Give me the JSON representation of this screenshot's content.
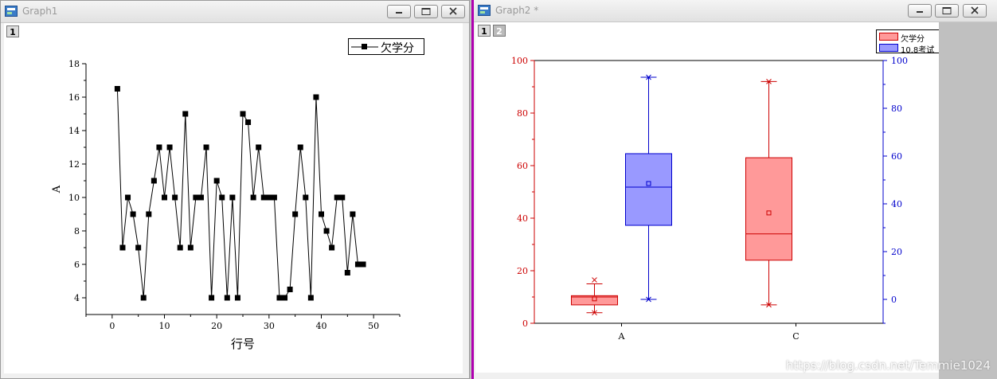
{
  "window1": {
    "title": "Graph1",
    "layer_tab": "1",
    "legend_label": "欠学分"
  },
  "window2": {
    "title": "Graph2 *",
    "layer_tabs": [
      "1",
      "2"
    ],
    "legend": [
      {
        "label": "欠学分",
        "color": "#ff9999"
      },
      {
        "label": "10.8考试",
        "color": "#9999ff"
      }
    ]
  },
  "watermark": "https://blog.csdn.net/Temmie1024",
  "chart_data": [
    {
      "type": "line",
      "xlabel": "行号",
      "ylabel": "A",
      "xlim": [
        -5,
        55
      ],
      "ylim": [
        3,
        18
      ],
      "xticks": [
        0,
        10,
        20,
        30,
        40,
        50
      ],
      "yticks": [
        4,
        6,
        8,
        10,
        12,
        14,
        16,
        18
      ],
      "markers": "square",
      "series": [
        {
          "name": "欠学分",
          "x": [
            1,
            2,
            3,
            4,
            5,
            6,
            7,
            8,
            9,
            10,
            11,
            12,
            13,
            14,
            15,
            16,
            17,
            18,
            19,
            20,
            21,
            22,
            23,
            24,
            25,
            26,
            27,
            28,
            29,
            30,
            31,
            32,
            33,
            34,
            35,
            36,
            37,
            38,
            39,
            40,
            41,
            42,
            43,
            44,
            45,
            46,
            47,
            48
          ],
          "y": [
            16.5,
            7,
            10,
            9,
            7,
            4,
            9,
            11,
            13,
            10,
            13,
            10,
            7,
            15,
            7,
            10,
            10,
            13,
            4,
            11,
            10,
            4,
            10,
            4,
            15,
            14.5,
            10,
            13,
            10,
            10,
            10,
            4,
            4,
            4.5,
            9,
            13,
            10,
            4,
            16,
            9,
            8,
            7,
            10,
            10,
            5.5,
            9,
            6,
            6
          ]
        }
      ]
    },
    {
      "type": "box",
      "categories": [
        "A",
        "C"
      ],
      "ylim_left": [
        0,
        100
      ],
      "yticks_left": [
        0,
        20,
        40,
        60,
        80,
        100
      ],
      "ylim_right": [
        -10,
        100
      ],
      "yticks_right": [
        0,
        20,
        40,
        60,
        80,
        100
      ],
      "series": [
        {
          "name": "欠学分",
          "axis": "left",
          "color": "#ff9999",
          "boxes": [
            {
              "category": "A",
              "whisker_low": 4,
              "q1": 7,
              "median": 10,
              "q3": 10.5,
              "whisker_high": 15,
              "mean": 9.3,
              "min": 4,
              "max": 16.5
            },
            {
              "category": "C",
              "whisker_low": 7,
              "q1": 24,
              "median": 34,
              "q3": 63,
              "whisker_high": 92,
              "mean": 42,
              "min": 7,
              "max": 92
            }
          ]
        },
        {
          "name": "10.8考试",
          "axis": "right",
          "color": "#9999ff",
          "boxes": [
            {
              "category": "A",
              "whisker_low": 0,
              "q1": 31,
              "median": 47,
              "q3": 61,
              "whisker_high": 93,
              "mean": 48.5,
              "min": 0,
              "max": 93
            }
          ]
        }
      ]
    }
  ]
}
